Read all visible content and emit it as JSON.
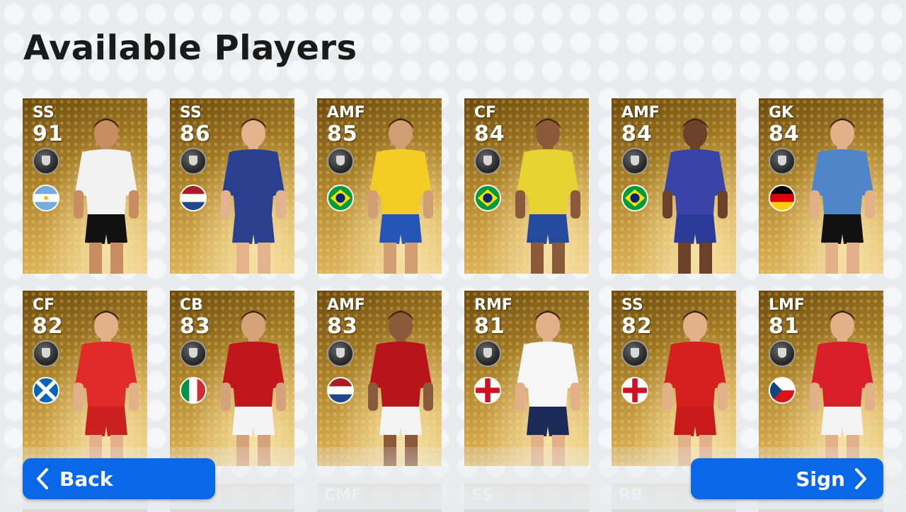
{
  "title": "Available Players",
  "buttons": {
    "back": "Back",
    "sign": "Sign"
  },
  "players": [
    {
      "pos": "SS",
      "rating": "91",
      "flag": "argentina",
      "shirt": "#f2f2f2",
      "shorts": "#111111",
      "skin": "#c98d62"
    },
    {
      "pos": "SS",
      "rating": "86",
      "flag": "netherlands",
      "shirt": "#2b3f8f",
      "shorts": "#2b3f8f",
      "skin": "#e3b38d"
    },
    {
      "pos": "AMF",
      "rating": "85",
      "flag": "brazil",
      "shirt": "#f3cc24",
      "shorts": "#2456b8",
      "skin": "#d29e74"
    },
    {
      "pos": "CF",
      "rating": "84",
      "flag": "brazil",
      "shirt": "#e6d331",
      "shorts": "#244aa0",
      "skin": "#8a5a3b"
    },
    {
      "pos": "AMF",
      "rating": "84",
      "flag": "brazil",
      "shirt": "#3a44a8",
      "shorts": "#2e3a9a",
      "skin": "#6b4129"
    },
    {
      "pos": "GK",
      "rating": "84",
      "flag": "germany",
      "shirt": "#4f86c9",
      "shorts": "#111111",
      "skin": "#e2b18a"
    },
    {
      "pos": "CF",
      "rating": "82",
      "flag": "scotland",
      "shirt": "#e12a2a",
      "shorts": "#cc1f1f",
      "skin": "#e2b18a"
    },
    {
      "pos": "CB",
      "rating": "83",
      "flag": "italy",
      "shirt": "#c0161c",
      "shorts": "#f4f4f4",
      "skin": "#d6a27a"
    },
    {
      "pos": "AMF",
      "rating": "83",
      "flag": "netherlands",
      "shirt": "#b8141b",
      "shorts": "#f4f4f4",
      "skin": "#8a5a3b"
    },
    {
      "pos": "RMF",
      "rating": "81",
      "flag": "england",
      "shirt": "#f6f6f6",
      "shorts": "#1c2a5a",
      "skin": "#e2b18a"
    },
    {
      "pos": "SS",
      "rating": "82",
      "flag": "england",
      "shirt": "#d61f1f",
      "shorts": "#c91a1a",
      "skin": "#e2b18a"
    },
    {
      "pos": "LMF",
      "rating": "81",
      "flag": "czech",
      "shirt": "#d9202a",
      "shorts": "#f4f4f4",
      "skin": "#e2b18a"
    }
  ],
  "partial_row": [
    "CMF",
    "SS",
    "RB"
  ]
}
